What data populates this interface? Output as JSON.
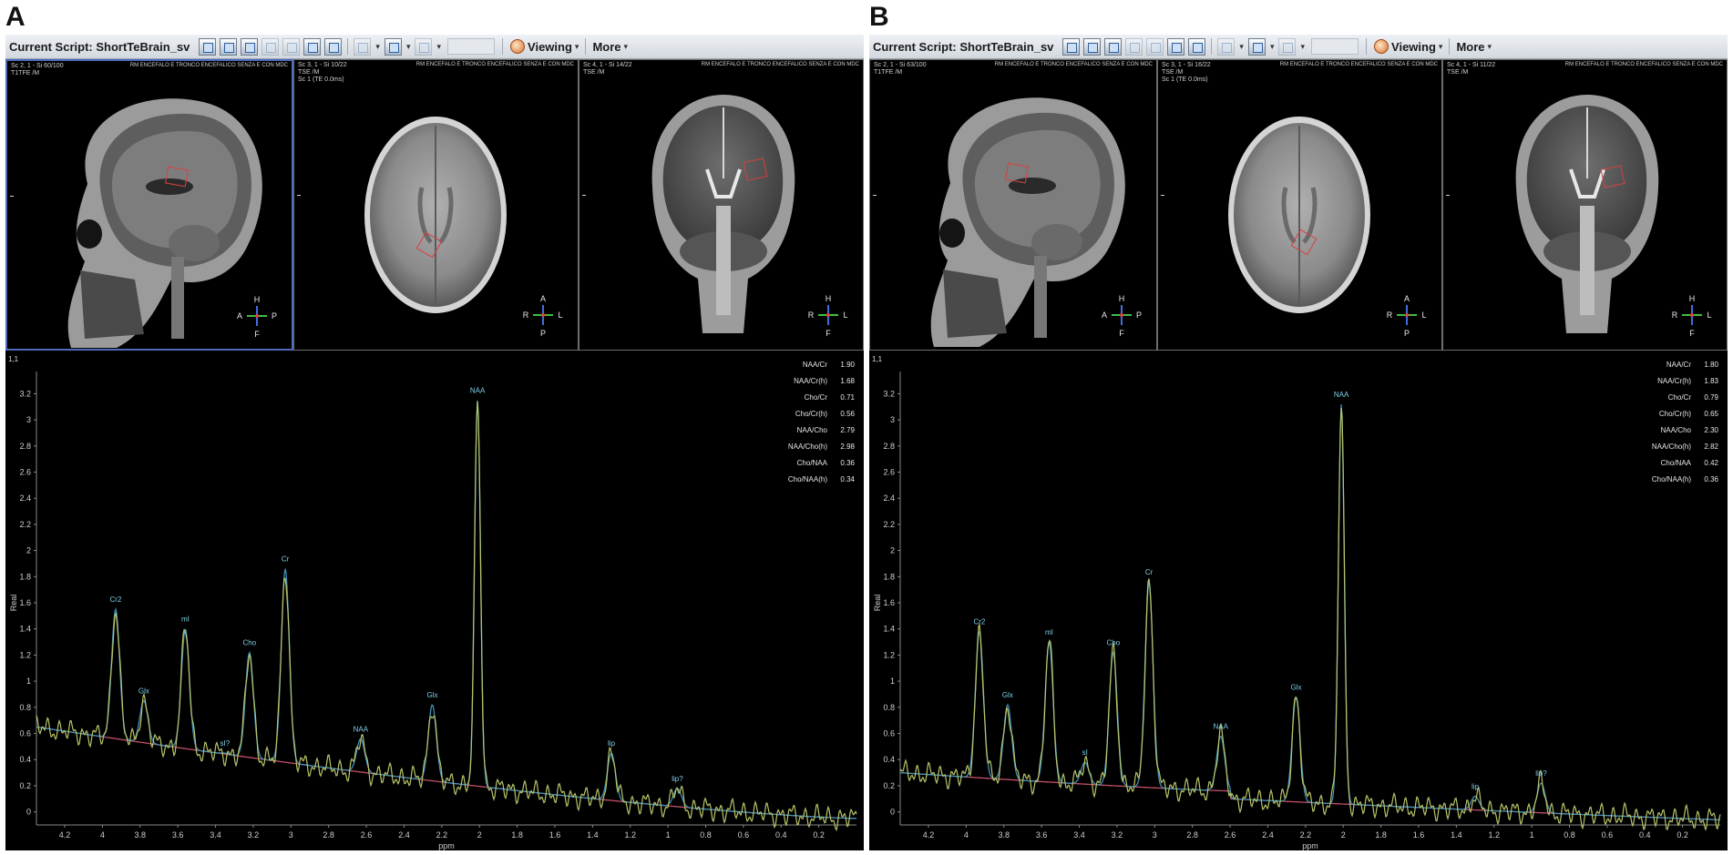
{
  "panels": [
    {
      "letter": "A",
      "toolbar": {
        "script_label": "Current Script: ShortTeBrain_sv",
        "viewing_label": "Viewing",
        "more_label": "More"
      },
      "viewports": [
        {
          "series_info": "Sc 2, 1 - Si 60/100\nT1TFE /M",
          "study_title": "RM ENCEFALO E TRONCO ENCEFALICO SENZA E CON MDC",
          "orientation": {
            "top": "H",
            "bottom": "F",
            "left": "A",
            "right": "P"
          }
        },
        {
          "series_info": "Sc 3, 1 - Si 10/22\nTSE /M\nSc 1 (TE 0.0ms)",
          "study_title": "RM ENCEFALO E TRONCO ENCEFALICO SENZA E CON MDC",
          "orientation": {
            "top": "A",
            "bottom": "P",
            "left": "R",
            "right": "L"
          }
        },
        {
          "series_info": "Sc 4, 1 - Si 14/22\nTSE /M",
          "study_title": "RM ENCEFALO E TRONCO ENCEFALICO SENZA E CON MDC",
          "orientation": {
            "top": "H",
            "bottom": "F",
            "left": "R",
            "right": "L"
          }
        }
      ],
      "spectrum": {
        "index_label": "1,1",
        "y_axis_label": "Real",
        "x_axis_label": "ppm",
        "y_ticks": [
          "0",
          "0.2",
          "0.4",
          "0.6",
          "0.8",
          "1",
          "1.2",
          "1.4",
          "1.6",
          "1.8",
          "2",
          "2.2",
          "2.4",
          "2.6",
          "2.8",
          "3",
          "3.2"
        ],
        "x_ticks": [
          "4.2",
          "4",
          "3.8",
          "3.6",
          "3.4",
          "3.2",
          "3",
          "2.8",
          "2.6",
          "2.4",
          "2.2",
          "2",
          "1.8",
          "1.6",
          "1.4",
          "1.2",
          "1",
          "0.8",
          "0.6",
          "0.4",
          "0.2"
        ],
        "ratios": [
          {
            "name": "NAA/Cr",
            "value": "1.90"
          },
          {
            "name": "NAA/Cr(h)",
            "value": "1.68"
          },
          {
            "name": "Cho/Cr",
            "value": "0.71"
          },
          {
            "name": "Cho/Cr(h)",
            "value": "0.56"
          },
          {
            "name": "NAA/Cho",
            "value": "2.79"
          },
          {
            "name": "NAA/Cho(h)",
            "value": "2.98"
          },
          {
            "name": "Cho/NAA",
            "value": "0.36"
          },
          {
            "name": "Cho/NAA(h)",
            "value": "0.34"
          }
        ],
        "peaks": [
          {
            "label": "Cr2",
            "ppm": 3.93,
            "height": 1.55
          },
          {
            "label": "Glx",
            "ppm": 3.78,
            "height": 0.85
          },
          {
            "label": "mI",
            "ppm": 3.56,
            "height": 1.4
          },
          {
            "label": "sI?",
            "ppm": 3.35,
            "height": 0.45
          },
          {
            "label": "Cho",
            "ppm": 3.22,
            "height": 1.22
          },
          {
            "label": "Cr",
            "ppm": 3.03,
            "height": 1.86
          },
          {
            "label": "NAA",
            "ppm": 2.63,
            "height": 0.56
          },
          {
            "label": "Glx",
            "ppm": 2.25,
            "height": 0.82
          },
          {
            "label": "NAA",
            "ppm": 2.01,
            "height": 3.15
          },
          {
            "label": "lip",
            "ppm": 1.3,
            "height": 0.45
          },
          {
            "label": "lip?",
            "ppm": 0.95,
            "height": 0.18
          }
        ],
        "baseline_start": 0.7
      }
    },
    {
      "letter": "B",
      "toolbar": {
        "script_label": "Current Script: ShortTeBrain_sv",
        "viewing_label": "Viewing",
        "more_label": "More"
      },
      "viewports": [
        {
          "series_info": "Sc 2, 1 - Si 63/100\nT1TFE /M",
          "study_title": "RM ENCEFALO E TRONCO ENCEFALICO SENZA E CON MDC",
          "orientation": {
            "top": "H",
            "bottom": "F",
            "left": "A",
            "right": "P"
          }
        },
        {
          "series_info": "Sc 3, 1 - Si 16/22\nTSE /M\nSc 1 (TE 0.0ms)",
          "study_title": "RM ENCEFALO E TRONCO ENCEFALICO SENZA E CON MDC",
          "orientation": {
            "top": "A",
            "bottom": "P",
            "left": "R",
            "right": "L"
          }
        },
        {
          "series_info": "Sc 4, 1 - Si 11/22\nTSE /M",
          "study_title": "RM ENCEFALO E TRONCO ENCEFALICO SENZA E CON MDC",
          "orientation": {
            "top": "H",
            "bottom": "F",
            "left": "R",
            "right": "L"
          }
        }
      ],
      "spectrum": {
        "index_label": "1,1",
        "y_axis_label": "Real",
        "x_axis_label": "ppm",
        "y_ticks": [
          "0",
          "0.2",
          "0.4",
          "0.6",
          "0.8",
          "1",
          "1.2",
          "1.4",
          "1.6",
          "1.8",
          "2",
          "2.2",
          "2.4",
          "2.6",
          "2.8",
          "3",
          "3.2"
        ],
        "x_ticks": [
          "4.2",
          "4",
          "3.8",
          "3.6",
          "3.4",
          "3.2",
          "3",
          "2.8",
          "2.6",
          "2.4",
          "2.2",
          "2",
          "1.8",
          "1.6",
          "1.4",
          "1.2",
          "1",
          "0.8",
          "0.6",
          "0.4",
          "0.2"
        ],
        "ratios": [
          {
            "name": "NAA/Cr",
            "value": "1.80"
          },
          {
            "name": "NAA/Cr(h)",
            "value": "1.83"
          },
          {
            "name": "Cho/Cr",
            "value": "0.79"
          },
          {
            "name": "Cho/Cr(h)",
            "value": "0.65"
          },
          {
            "name": "NAA/Cho",
            "value": "2.30"
          },
          {
            "name": "NAA/Cho(h)",
            "value": "2.82"
          },
          {
            "name": "Cho/NAA",
            "value": "0.42"
          },
          {
            "name": "Cho/NAA(h)",
            "value": "0.36"
          }
        ],
        "peaks": [
          {
            "label": "Cr2",
            "ppm": 3.93,
            "height": 1.38
          },
          {
            "label": "Glx",
            "ppm": 3.78,
            "height": 0.82
          },
          {
            "label": "mI",
            "ppm": 3.56,
            "height": 1.3
          },
          {
            "label": "sI",
            "ppm": 3.37,
            "height": 0.38
          },
          {
            "label": "Cho",
            "ppm": 3.22,
            "height": 1.22
          },
          {
            "label": "Cr",
            "ppm": 3.03,
            "height": 1.76
          },
          {
            "label": "NAA",
            "ppm": 2.65,
            "height": 0.58
          },
          {
            "label": "Glx",
            "ppm": 2.25,
            "height": 0.88
          },
          {
            "label": "NAA",
            "ppm": 2.01,
            "height": 3.12
          },
          {
            "label": "lip",
            "ppm": 1.3,
            "height": 0.12
          },
          {
            "label": "lip?",
            "ppm": 0.95,
            "height": 0.22
          }
        ],
        "baseline_start": 0.3
      }
    }
  ]
}
